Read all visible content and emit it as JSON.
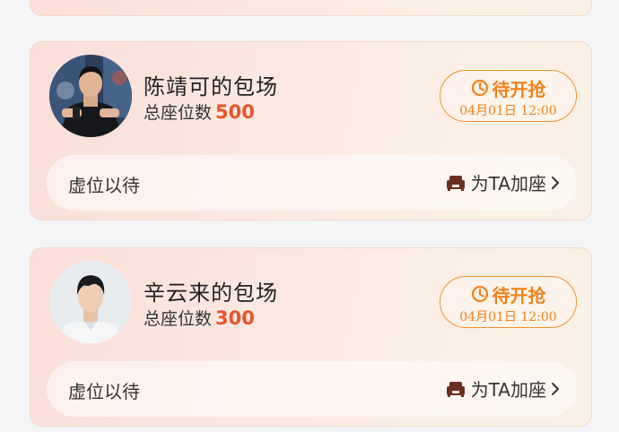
{
  "cards": [
    {
      "host_name": "陈靖可的包场",
      "seat_label": "总座位数",
      "seat_total": "500",
      "status_label": "待开抢",
      "status_time": "04月01日 12:00",
      "vacant_text": "虚位以待",
      "add_seat_label": "为TA加座"
    },
    {
      "host_name": "辛云来的包场",
      "seat_label": "总座位数",
      "seat_total": "300",
      "status_label": "待开抢",
      "status_time": "04月01日 12:00",
      "vacant_text": "虚位以待",
      "add_seat_label": "为TA加座"
    }
  ],
  "colors": {
    "accent_orange": "#f0821c",
    "seat_number_red": "#e8542a",
    "card_border": "#f3d9c9",
    "icon_brown": "#6b2e22"
  },
  "icons": {
    "status": "clock-icon",
    "add_seat": "sofa-icon",
    "chevron": "chevron-right-icon"
  }
}
